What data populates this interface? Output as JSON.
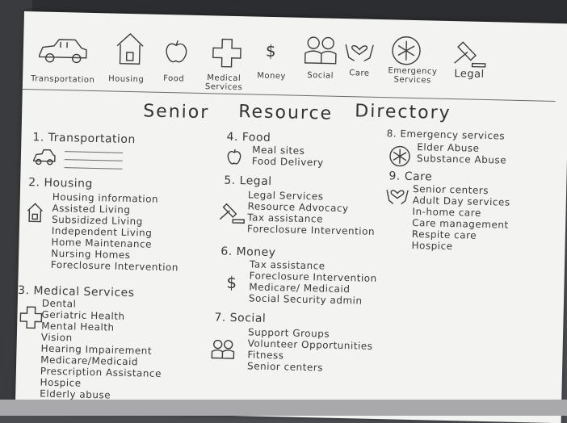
{
  "icon_bar": {
    "transportation": "Transportation",
    "housing": "Housing",
    "food": "Food",
    "medical_line1": "Medical",
    "medical_line2": "Services",
    "money": "Money",
    "social": "Social",
    "care": "Care",
    "emergency_line1": "Emergency",
    "emergency_line2": "Services",
    "legal": "Legal"
  },
  "title": {
    "word1": "Senior",
    "word2": "Resource",
    "word3": "Directory"
  },
  "sections": {
    "transportation": {
      "heading": "1. Transportation"
    },
    "housing": {
      "heading": "2. Housing",
      "items": [
        "Housing information",
        "Assisted Living",
        "Subsidized Living",
        "Independent Living",
        "Home Maintenance",
        "Nursing Homes",
        "Foreclosure Intervention"
      ]
    },
    "medical": {
      "heading": "3. Medical Services",
      "items": [
        "Dental",
        "Geriatric Health",
        "Mental Health",
        "Vision",
        "Hearing Impairement",
        "Medicare/Medicaid",
        "Prescription Assistance",
        "Hospice",
        "Elderly abuse"
      ]
    },
    "food": {
      "heading": "4. Food",
      "items": [
        "Meal sites",
        "Food Delivery"
      ]
    },
    "legal": {
      "heading": "5. Legal",
      "items": [
        "Legal Services",
        "Resource Advocacy",
        "Tax assistance",
        "Foreclosure Intervention"
      ]
    },
    "money": {
      "heading": "6. Money",
      "items": [
        "Tax assistance",
        "Foreclosure Intervention",
        "Medicare/ Medicaid",
        "Social Security admin"
      ]
    },
    "social": {
      "heading": "7. Social",
      "items": [
        "Support Groups",
        "Volunteer Opportunities",
        "Fitness",
        "Senior centers"
      ]
    },
    "emergency": {
      "heading": "8. Emergency services",
      "items": [
        "Elder Abuse",
        "Substance Abuse"
      ]
    },
    "care": {
      "heading": "9. Care",
      "items": [
        "Senior centers",
        "Adult Day services",
        "In-home care",
        "Care management",
        "Respite care",
        "Hospice"
      ]
    }
  },
  "money_symbol": "$"
}
